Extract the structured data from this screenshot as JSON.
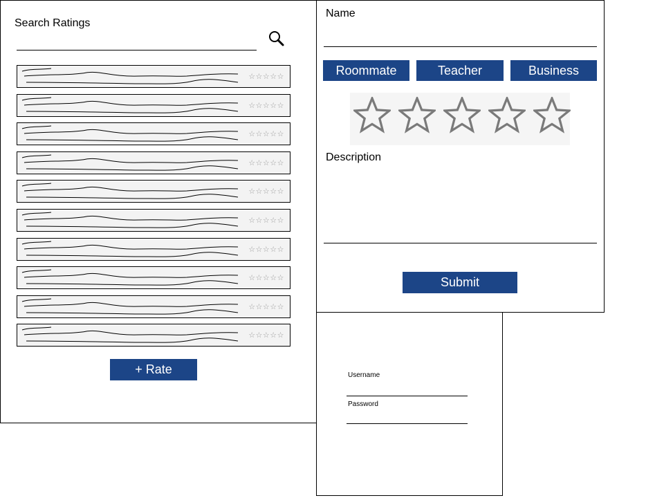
{
  "search_panel": {
    "title": "Search Ratings",
    "search_value": "",
    "items": [
      {
        "rating": "☆☆☆☆☆"
      },
      {
        "rating": "☆☆☆☆☆"
      },
      {
        "rating": "☆☆☆☆☆"
      },
      {
        "rating": "☆☆☆☆☆"
      },
      {
        "rating": "☆☆☆☆☆"
      },
      {
        "rating": "☆☆☆☆☆"
      },
      {
        "rating": "☆☆☆☆☆"
      },
      {
        "rating": "☆☆☆☆☆"
      },
      {
        "rating": "☆☆☆☆☆"
      },
      {
        "rating": "☆☆☆☆☆"
      }
    ],
    "rate_button": "+ Rate"
  },
  "rate_panel": {
    "name_label": "Name",
    "name_value": "",
    "categories": [
      "Roommate",
      "Teacher",
      "Business"
    ],
    "stars": 5,
    "rating_value": 0,
    "description_label": "Description",
    "description_value": "",
    "submit_label": "Submit"
  },
  "login_panel": {
    "username_label": "Username",
    "username_value": "",
    "password_label": "Password",
    "password_value": ""
  },
  "icons": {
    "search": "search-icon",
    "star": "star-icon"
  },
  "colors": {
    "accent": "#1c4587",
    "star_outline": "#7a7a7a",
    "list_bg": "#f3f3f3"
  }
}
